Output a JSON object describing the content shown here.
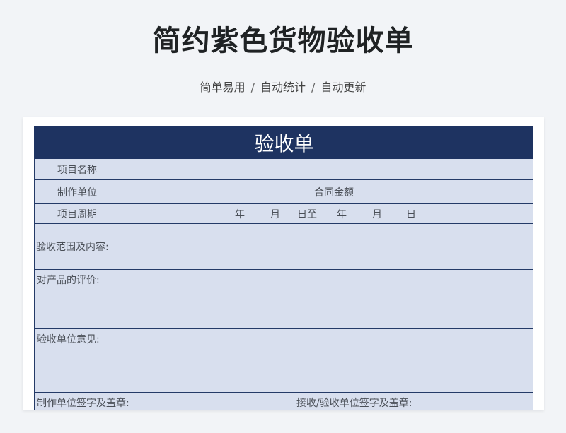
{
  "header": {
    "title": "简约紫色货物验收单",
    "subtitle_parts": [
      "简单易用",
      "自动统计",
      "自动更新"
    ],
    "separator": "/"
  },
  "form": {
    "title": "验收单",
    "project_name_label": "项目名称",
    "maker_unit_label": "制作单位",
    "contract_amount_label": "合同金额",
    "project_period_label": "项目周期",
    "period_parts": [
      "年",
      "月",
      "日至",
      "年",
      "月",
      "日"
    ],
    "scope_label": "验收范围及内容:",
    "evaluation_label": "对产品的评价:",
    "acceptance_opinion_label": "验收单位意见:",
    "maker_sign_label": "制作单位签字及盖章:",
    "receiver_sign_label": "接收/验收单位签字及盖章:"
  },
  "colors": {
    "header_bg": "#1e3361",
    "cell_bg": "#d8dfee",
    "border": "#243a67",
    "page_bg": "#f2f4f7"
  }
}
